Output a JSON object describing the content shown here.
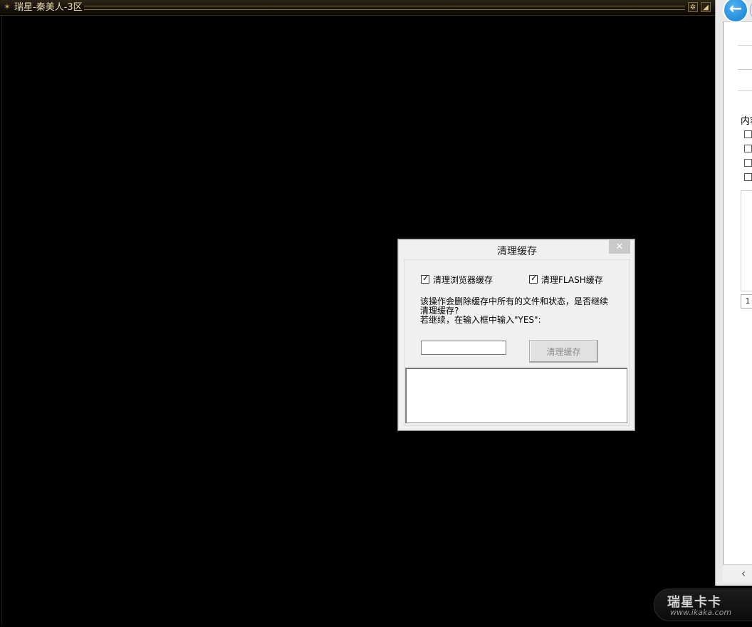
{
  "game_window": {
    "title": "瑞星-秦美人-3区",
    "settings_icon": "gear-icon",
    "minimize_icon": "minimize-icon"
  },
  "side_panel": {
    "back_icon": "arrow-left-icon",
    "label_partial": "内容",
    "page_number": "1",
    "scroll_icon": "chevron-left-icon"
  },
  "dialog": {
    "title": "清理缓存",
    "close_glyph": "✕",
    "checkbox_browser": {
      "label": "清理浏览器缓存",
      "checked": true
    },
    "checkbox_flash": {
      "label": "清理FLASH缓存",
      "checked": true
    },
    "message_line1": "该操作会删除缓存中所有的文件和状态，是否继续清理缓存?",
    "message_line2": "若继续，在输入框中输入\"YES\":",
    "input_value": "",
    "button_label": "清理缓存",
    "log_text": ""
  },
  "watermark": {
    "brand": "瑞星卡卡",
    "url": "www.ikaka.com"
  },
  "colors": {
    "game_background": "#000000",
    "dialog_background": "#f0f0f0",
    "accent_blue": "#127bd0"
  }
}
